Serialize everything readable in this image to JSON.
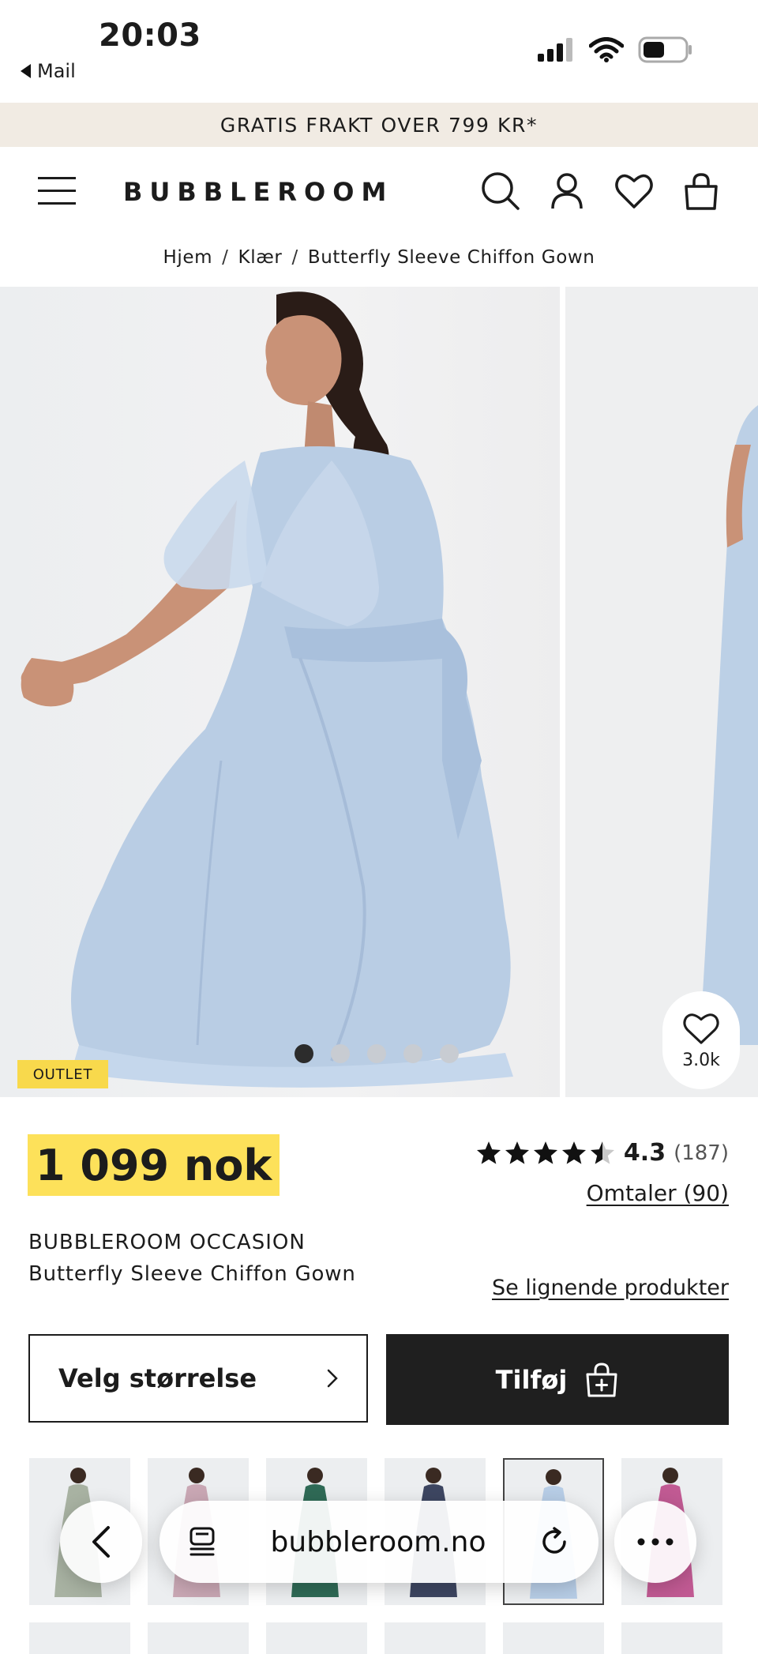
{
  "status_bar": {
    "time": "20:03",
    "back_label": "Mail"
  },
  "banner": {
    "text": "GRATIS FRAKT OVER 799 KR*"
  },
  "header": {
    "logo": "BUBBLEROOM"
  },
  "breadcrumb": {
    "items": [
      "Hjem",
      "Klær",
      "Butterfly Sleeve Chiffon Gown"
    ],
    "separator": "/"
  },
  "gallery": {
    "badge": "OUTLET",
    "wishlist_count": "3.0k",
    "slide_count": 5,
    "active_slide": 1,
    "dress_color": "#b9cde4"
  },
  "product": {
    "price": "1 099 nok",
    "rating_value": "4.3",
    "rating_count": "(187)",
    "rating_stars": 4.3,
    "reviews_link": "Omtaler (90)",
    "brand": "BUBBLEROOM OCCASION",
    "name": "Butterfly Sleeve Chiffon Gown",
    "similar_link": "Se lignende produkter"
  },
  "actions": {
    "size_label": "Velg størrelse",
    "add_label": "Tilføj"
  },
  "thumbnails": [
    {
      "color": "#a8b2a2"
    },
    {
      "color": "#c9a7b4"
    },
    {
      "color": "#2f6a56"
    },
    {
      "color": "#3d4661"
    },
    {
      "color": "#b7cde6",
      "selected": true
    },
    {
      "color": "#c15a93"
    }
  ],
  "browser": {
    "url": "bubbleroom.no"
  },
  "colors": {
    "accent_yellow": "#fde15a",
    "banner_bg": "#f1ebe3",
    "button_dark": "#1f1f1f"
  }
}
